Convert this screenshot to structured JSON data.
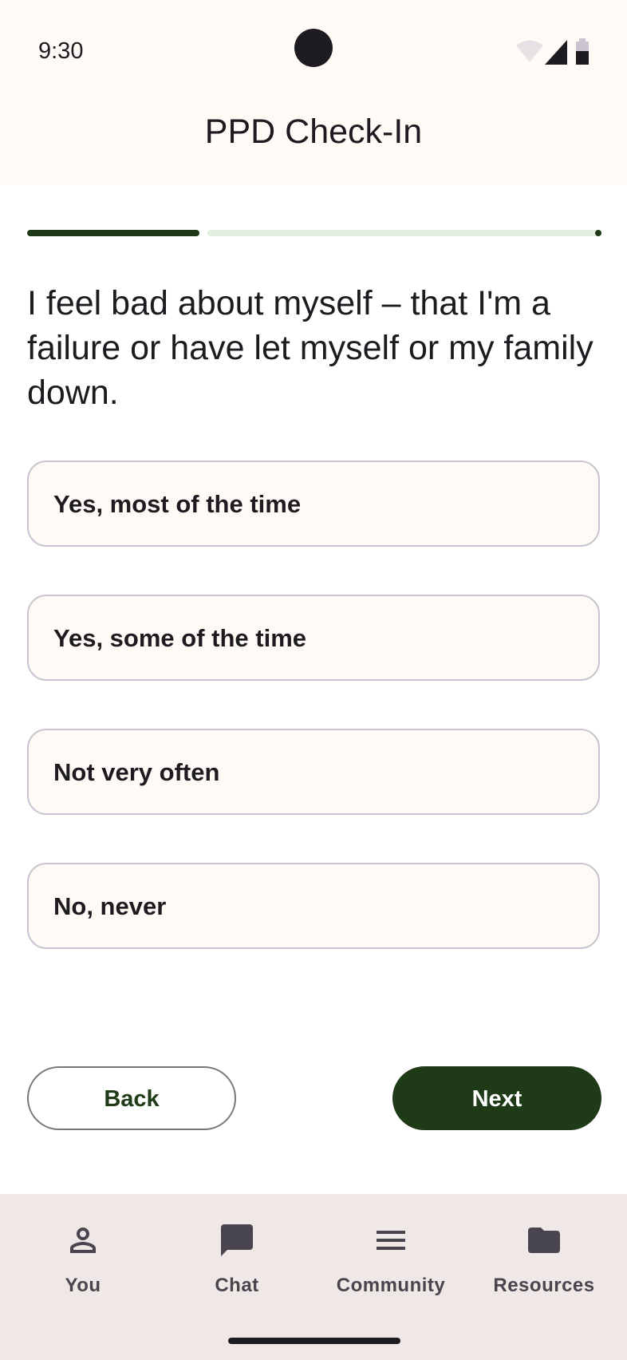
{
  "status_bar": {
    "time": "9:30",
    "icons": [
      "wifi-icon",
      "cellular-signal-icon",
      "battery-icon"
    ]
  },
  "app_bar": {
    "title": "PPD Check-In"
  },
  "progress": {
    "fraction": 0.3
  },
  "question": {
    "text": "I feel bad about myself – that I'm a failure or have let myself or my family down."
  },
  "options": [
    {
      "label": "Yes, most of the time"
    },
    {
      "label": "Yes, some of the time"
    },
    {
      "label": "Not very often"
    },
    {
      "label": "No, never"
    }
  ],
  "actions": {
    "back_label": "Back",
    "next_label": "Next"
  },
  "bottom_nav": {
    "items": [
      {
        "label": "You",
        "icon": "person-icon"
      },
      {
        "label": "Chat",
        "icon": "chat-bubble-icon"
      },
      {
        "label": "Community",
        "icon": "menu-lines-icon"
      },
      {
        "label": "Resources",
        "icon": "folder-icon"
      }
    ]
  },
  "colors": {
    "primary": "#1F3A17",
    "header_background": "#FEFBF6",
    "progress_track": "#E3EEE0",
    "nav_background": "#F0E8E6",
    "option_border": "#CAC4D0"
  }
}
